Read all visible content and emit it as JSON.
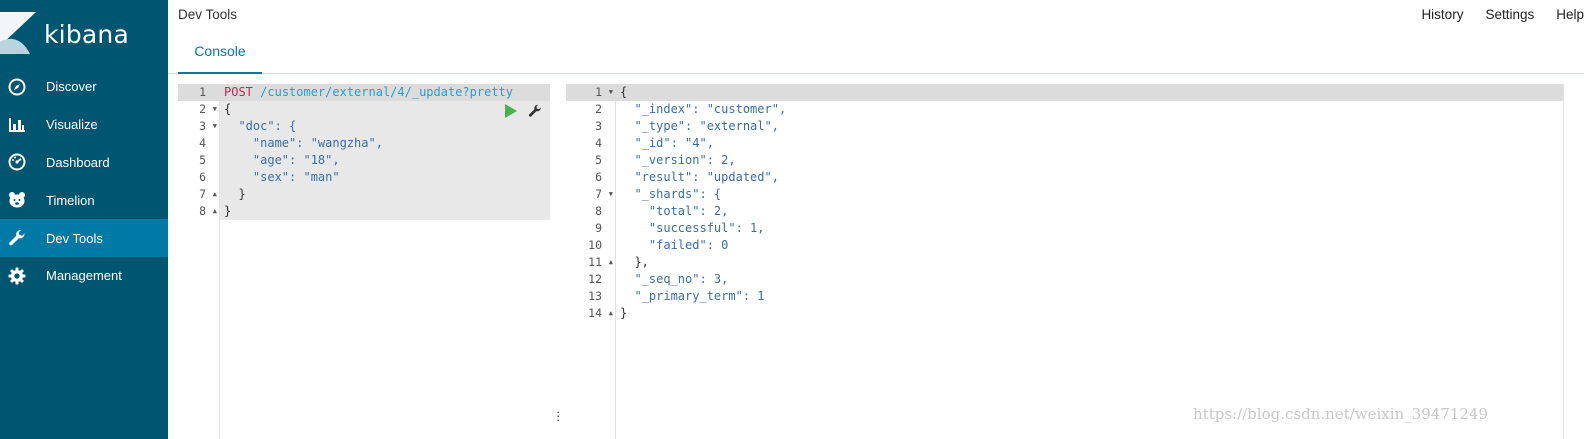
{
  "brand": {
    "name": "kibana"
  },
  "sidebar": {
    "items": [
      {
        "label": "Discover",
        "icon": "compass-icon",
        "active": false
      },
      {
        "label": "Visualize",
        "icon": "bar-chart-icon",
        "active": false
      },
      {
        "label": "Dashboard",
        "icon": "dashboard-icon",
        "active": false
      },
      {
        "label": "Timelion",
        "icon": "timelion-bear-icon",
        "active": false
      },
      {
        "label": "Dev Tools",
        "icon": "wrench-icon",
        "active": true
      },
      {
        "label": "Management",
        "icon": "gear-icon",
        "active": false
      }
    ]
  },
  "header": {
    "title": "Dev Tools",
    "links": [
      "History",
      "Settings",
      "Help"
    ]
  },
  "tabs": [
    {
      "label": "Console",
      "active": true
    }
  ],
  "request": {
    "method": "POST",
    "url": "/customer/external/4/_update?pretty",
    "lines": [
      "{",
      "  \"doc\": {",
      "    \"name\": \"wangzha\",",
      "    \"age\": \"18\",",
      "    \"sex\": \"man\"",
      "  }",
      "}"
    ]
  },
  "response": {
    "lines": [
      "{",
      "  \"_index\": \"customer\",",
      "  \"_type\": \"external\",",
      "  \"_id\": \"4\",",
      "  \"_version\": 2,",
      "  \"result\": \"updated\",",
      "  \"_shards\": {",
      "    \"total\": 2,",
      "    \"successful\": 1,",
      "    \"failed\": 0",
      "  },",
      "  \"_seq_no\": 3,",
      "  \"_primary_term\": 1",
      "}"
    ]
  },
  "colors": {
    "sidebar": "#005571",
    "sidebar_active": "#0079a5",
    "accent": "#0079a5",
    "method": "#c7254e",
    "url": "#2a9ccf",
    "run": "#4caf50"
  },
  "watermark": "https://blog.csdn.net/weixin_39471249"
}
